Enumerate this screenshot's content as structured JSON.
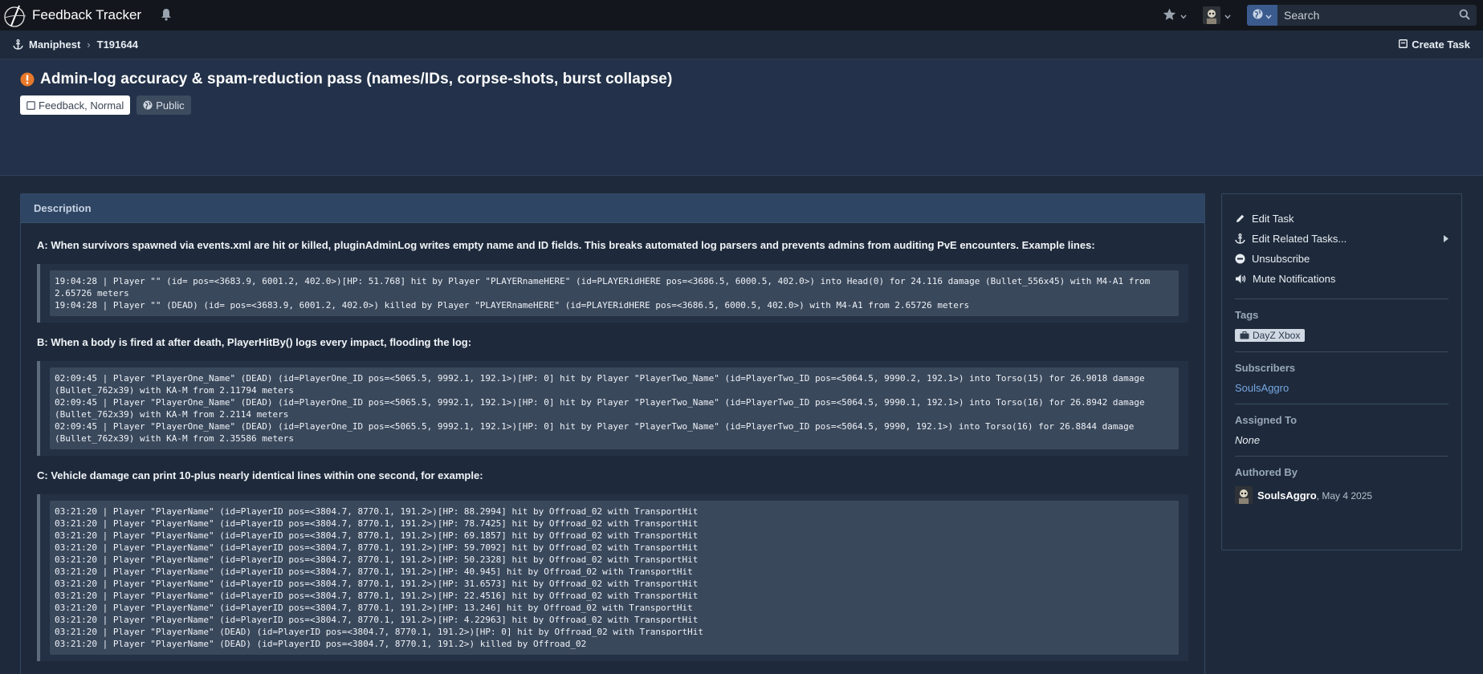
{
  "app": {
    "name": "Feedback Tracker",
    "search_placeholder": "Search"
  },
  "breadcrumb": {
    "root": "Maniphest",
    "current": "T191644",
    "create_label": "Create Task"
  },
  "task": {
    "title": "Admin-log accuracy & spam-reduction pass (names/IDs, corpse-shots, burst collapse)",
    "status_label": "Feedback, Normal",
    "visibility_label": "Public"
  },
  "description": {
    "header": "Description",
    "section_a": "A: When survivors spawned via events.xml are hit or killed, pluginAdminLog writes empty name and ID fields. This breaks automated log parsers and prevents admins from auditing PvE encounters. Example lines:",
    "code_a": [
      "19:04:28 | Player \"\" (id= pos=<3683.9, 6001.2, 402.0>)[HP: 51.768] hit by Player \"PLAYERnameHERE\" (id=PLAYERidHERE pos=<3686.5, 6000.5, 402.0>) into Head(0) for 24.116 damage (Bullet_556x45) with M4-A1 from 2.65726 meters",
      "19:04:28 | Player \"\" (DEAD) (id= pos=<3683.9, 6001.2, 402.0>) killed by Player \"PLAYERnameHERE\" (id=PLAYERidHERE pos=<3686.5, 6000.5, 402.0>) with M4-A1 from 2.65726 meters"
    ],
    "section_b": "B: When a body is fired at after death, PlayerHitBy() logs every impact, flooding the log:",
    "code_b": [
      "02:09:45 | Player \"PlayerOne_Name\" (DEAD) (id=PlayerOne_ID pos=<5065.5, 9992.1, 192.1>)[HP: 0] hit by Player \"PlayerTwo_Name\" (id=PlayerTwo_ID pos=<5064.5, 9990.2, 192.1>) into Torso(15) for 26.9018 damage (Bullet_762x39) with KA-M from 2.11794 meters",
      "02:09:45 | Player \"PlayerOne_Name\" (DEAD) (id=PlayerOne_ID pos=<5065.5, 9992.1, 192.1>)[HP: 0] hit by Player \"PlayerTwo_Name\" (id=PlayerTwo_ID pos=<5064.5, 9990.1, 192.1>) into Torso(16) for 26.8942 damage (Bullet_762x39) with KA-M from 2.2114 meters",
      "02:09:45 | Player \"PlayerOne_Name\" (DEAD) (id=PlayerOne_ID pos=<5065.5, 9992.1, 192.1>)[HP: 0] hit by Player \"PlayerTwo_Name\" (id=PlayerTwo_ID pos=<5064.5, 9990, 192.1>) into Torso(16) for 26.8844 damage (Bullet_762x39) with KA-M from 2.35586 meters"
    ],
    "section_c": "C: Vehicle damage can print 10-plus nearly identical lines within one second, for example:",
    "code_c": [
      "03:21:20 | Player \"PlayerName\" (id=PlayerID pos=<3804.7, 8770.1, 191.2>)[HP: 88.2994] hit by Offroad_02 with TransportHit",
      "03:21:20 | Player \"PlayerName\" (id=PlayerID pos=<3804.7, 8770.1, 191.2>)[HP: 78.7425] hit by Offroad_02 with TransportHit",
      "03:21:20 | Player \"PlayerName\" (id=PlayerID pos=<3804.7, 8770.1, 191.2>)[HP: 69.1857] hit by Offroad_02 with TransportHit",
      "03:21:20 | Player \"PlayerName\" (id=PlayerID pos=<3804.7, 8770.1, 191.2>)[HP: 59.7092] hit by Offroad_02 with TransportHit",
      "03:21:20 | Player \"PlayerName\" (id=PlayerID pos=<3804.7, 8770.1, 191.2>)[HP: 50.2328] hit by Offroad_02 with TransportHit",
      "03:21:20 | Player \"PlayerName\" (id=PlayerID pos=<3804.7, 8770.1, 191.2>)[HP: 40.945] hit by Offroad_02 with TransportHit",
      "03:21:20 | Player \"PlayerName\" (id=PlayerID pos=<3804.7, 8770.1, 191.2>)[HP: 31.6573] hit by Offroad_02 with TransportHit",
      "03:21:20 | Player \"PlayerName\" (id=PlayerID pos=<3804.7, 8770.1, 191.2>)[HP: 22.4516] hit by Offroad_02 with TransportHit",
      "03:21:20 | Player \"PlayerName\" (id=PlayerID pos=<3804.7, 8770.1, 191.2>)[HP: 13.246] hit by Offroad_02 with TransportHit",
      "03:21:20 | Player \"PlayerName\" (id=PlayerID pos=<3804.7, 8770.1, 191.2>)[HP: 4.22963] hit by Offroad_02 with TransportHit",
      "03:21:20 | Player \"PlayerName\" (DEAD) (id=PlayerID pos=<3804.7, 8770.1, 191.2>)[HP: 0] hit by Offroad_02 with TransportHit",
      "03:21:20 | Player \"PlayerName\" (DEAD) (id=PlayerID pos=<3804.7, 8770.1, 191.2>) killed by Offroad_02"
    ]
  },
  "sidebar": {
    "actions": [
      "Edit Task",
      "Edit Related Tasks...",
      "Unsubscribe",
      "Mute Notifications"
    ],
    "tags_label": "Tags",
    "tag": "DayZ Xbox",
    "subscribers_label": "Subscribers",
    "subscriber": "SoulsAggro",
    "assigned_label": "Assigned To",
    "assigned_value": "None",
    "authored_label": "Authored By",
    "author": "SoulsAggro",
    "authored_date": ", May 4 2025"
  },
  "colors": {
    "accent": "#3b5a8e",
    "link": "#77a7e3",
    "priority_icon": "#e8782a"
  },
  "icons": [
    "logo-icon",
    "bell-icon",
    "star-icon",
    "avatar",
    "globe-icon",
    "search-icon",
    "anchor-icon",
    "create-task-icon",
    "warning-icon",
    "checkbox-icon",
    "pencil-icon",
    "link-icon",
    "minus-circle-icon",
    "mute-icon",
    "briefcase-icon"
  ]
}
